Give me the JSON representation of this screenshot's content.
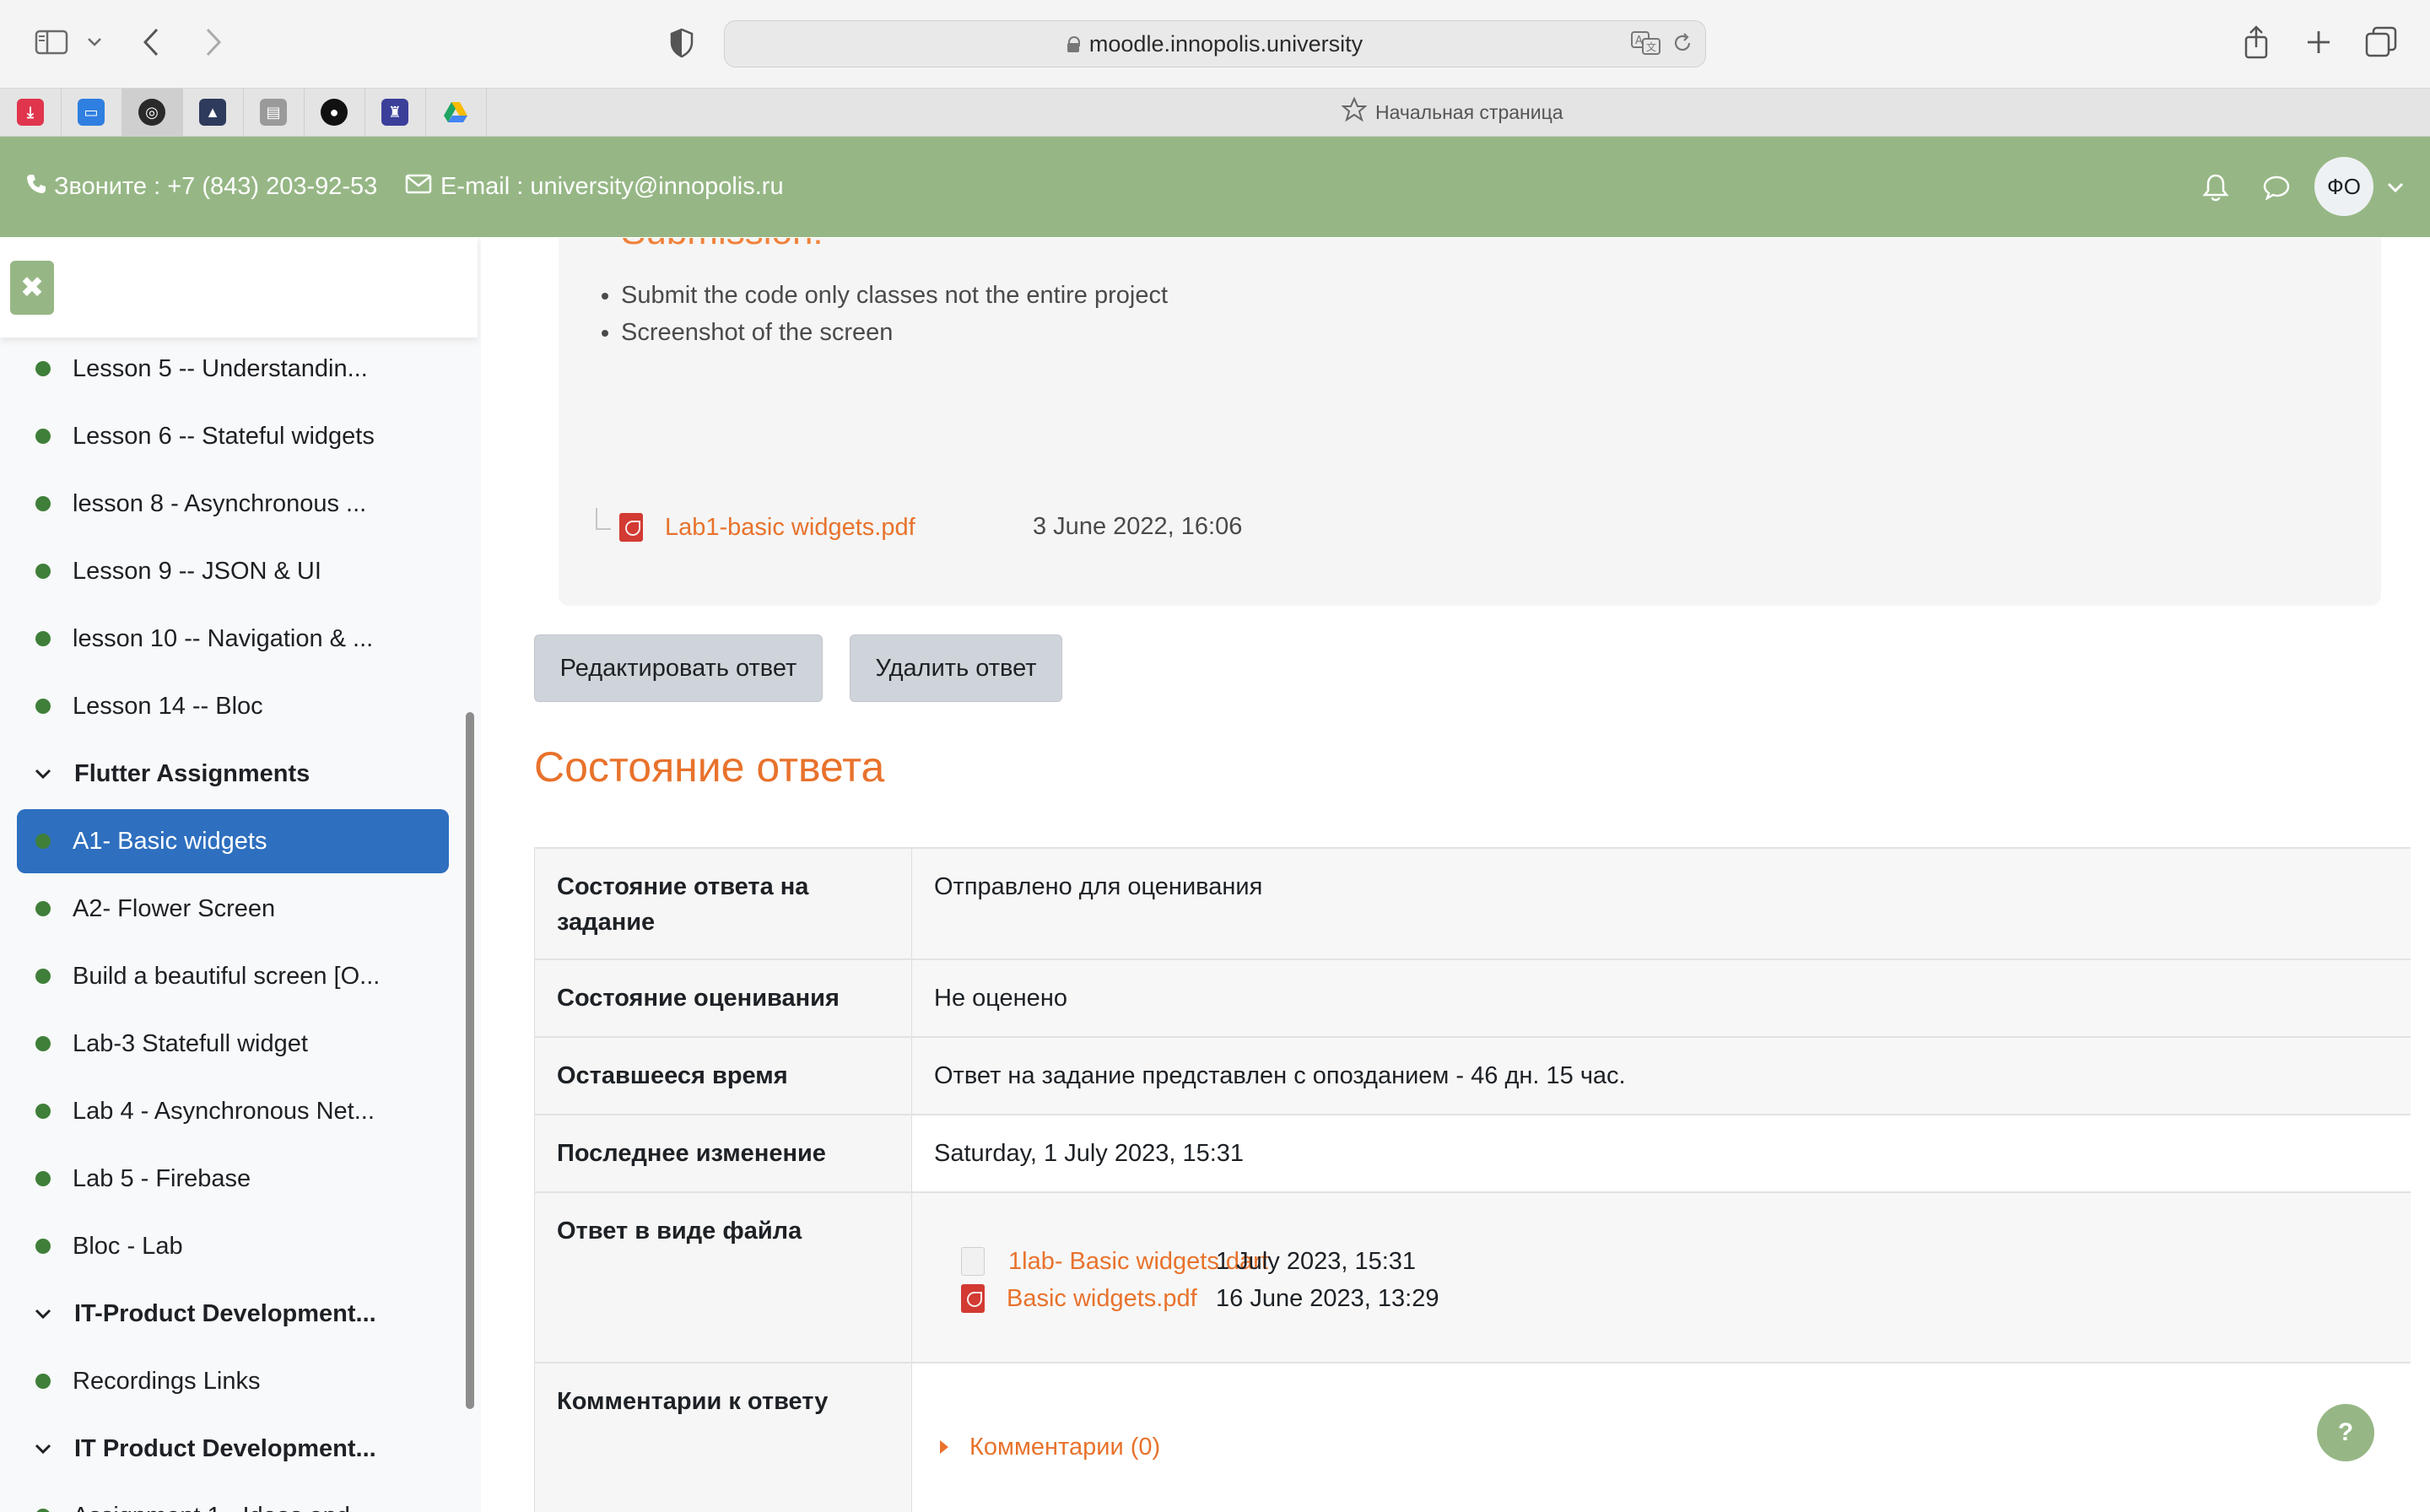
{
  "browser": {
    "url": "moodle.innopolis.university",
    "favorites_title": "Начальная страница"
  },
  "header": {
    "phone": "Звоните : +7 (843) 203-92-53",
    "email": "E-mail : university@innopolis.ru",
    "avatar_initials": "ФО"
  },
  "sidebar": {
    "close_symbol": "✖",
    "items": [
      {
        "type": "item",
        "label": "Lesson 5 -- Understandin..."
      },
      {
        "type": "item",
        "label": "Lesson 6 -- Stateful widgets"
      },
      {
        "type": "item",
        "label": "lesson 8 - Asynchronous ..."
      },
      {
        "type": "item",
        "label": "Lesson 9 -- JSON & UI"
      },
      {
        "type": "item",
        "label": "lesson 10 -- Navigation & ..."
      },
      {
        "type": "item",
        "label": "Lesson 14 -- Bloc"
      },
      {
        "type": "section",
        "label": "Flutter Assignments"
      },
      {
        "type": "item",
        "label": "A1- Basic widgets",
        "active": true
      },
      {
        "type": "item",
        "label": "A2- Flower Screen"
      },
      {
        "type": "item",
        "label": "Build a beautiful screen [O..."
      },
      {
        "type": "item",
        "label": "Lab-3 Statefull widget"
      },
      {
        "type": "item",
        "label": "Lab 4 - Asynchronous Net..."
      },
      {
        "type": "item",
        "label": "Lab 5 - Firebase"
      },
      {
        "type": "item",
        "label": "Bloc - Lab"
      },
      {
        "type": "section",
        "label": "IT-Product Development..."
      },
      {
        "type": "item",
        "label": "Recordings Links"
      },
      {
        "type": "section",
        "label": "IT Product Development..."
      },
      {
        "type": "item",
        "label": "Assignment 1 - Ideas and..."
      }
    ]
  },
  "assignment": {
    "submission_heading": "Submission:",
    "bullets": [
      "Submit the code only classes not the entire project",
      "Screenshot of the screen"
    ],
    "attachment": {
      "name": "Lab1-basic widgets.pdf",
      "date": "3 June 2022, 16:06"
    }
  },
  "actions": {
    "edit_label": "Редактировать ответ",
    "delete_label": "Удалить ответ"
  },
  "status": {
    "heading": "Состояние ответа",
    "rows": [
      {
        "label": "Состояние ответа на задание",
        "value": "Отправлено для оценивания"
      },
      {
        "label": "Состояние оценивания",
        "value": "Не оценено"
      },
      {
        "label": "Оставшееся время",
        "value": "Ответ на задание представлен с опозданием - 46 дн. 15 час."
      },
      {
        "label": "Последнее изменение",
        "value": "Saturday, 1 July 2023, 15:31"
      },
      {
        "label": "Ответ в виде файла",
        "value": ""
      },
      {
        "label": "Комментарии к ответу",
        "value": ""
      }
    ],
    "files": [
      {
        "name": "1lab- Basic widgets.dart",
        "date": "1 July 2023, 15:31",
        "icon": "dart-file-icon"
      },
      {
        "name": "Basic widgets.pdf",
        "date": "16 June 2023, 13:29",
        "icon": "pdf-icon"
      }
    ],
    "comments_link": "Комментарии (0)"
  },
  "help": {
    "label": "?"
  },
  "colors": {
    "brand_green": "#96b785",
    "accent_orange": "#e8722c",
    "active_blue": "#2e6fbf"
  }
}
